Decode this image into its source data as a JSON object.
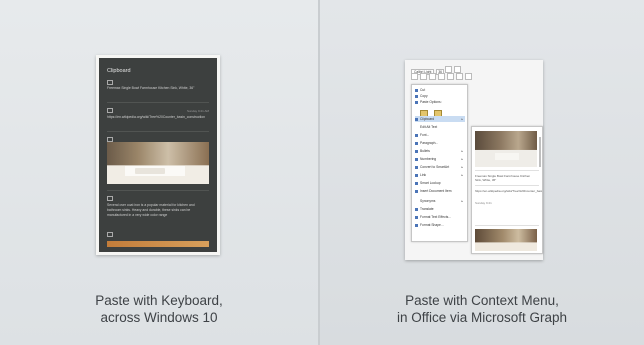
{
  "left": {
    "caption_line1": "Paste with Keyboard,",
    "caption_line2": "across Windows 10",
    "clipboard": {
      "title": "Clipboard",
      "items": [
        {
          "text": "Freemax Single Bowl Farmhouse Kitchen Sink, White, 36\"",
          "time": ""
        },
        {
          "text": "https://en.wikipedia.org/wiki/Tree%20Counter_basin_construction",
          "time": "Sunday 9:21 AM"
        },
        {
          "text": "Several over coat iron is a popular material for kitchen and bathroom sinks. Heavy and durable, these sinks can be manufactured in a very wide color range",
          "time": ""
        }
      ]
    }
  },
  "right": {
    "caption_line1": "Paste with Context Menu,",
    "caption_line2": "in Office via Microsoft Graph",
    "font_box": "Calibri Light",
    "font_size": "36",
    "context_menu": {
      "items": [
        "Cut",
        "Copy",
        "Paste Options:",
        "Clipboard",
        "Edit Alt Text",
        "Font...",
        "Paragraph...",
        "Bullets",
        "Numbering",
        "Convert to SmartArt",
        "Link",
        "Smart Lookup",
        "Insert Document Item",
        "Synonyms",
        "Translate",
        "Format Text Effects...",
        "Format Shape..."
      ],
      "selected": "Clipboard"
    },
    "flyout": {
      "items": [
        "Freemax Single Bowl Farmhouse Kitchen Sink, White, 36\"",
        "https://en.wikipedia.org/wiki/Tree%20Counter_basin_construction",
        "Sunday 9:21"
      ]
    }
  }
}
